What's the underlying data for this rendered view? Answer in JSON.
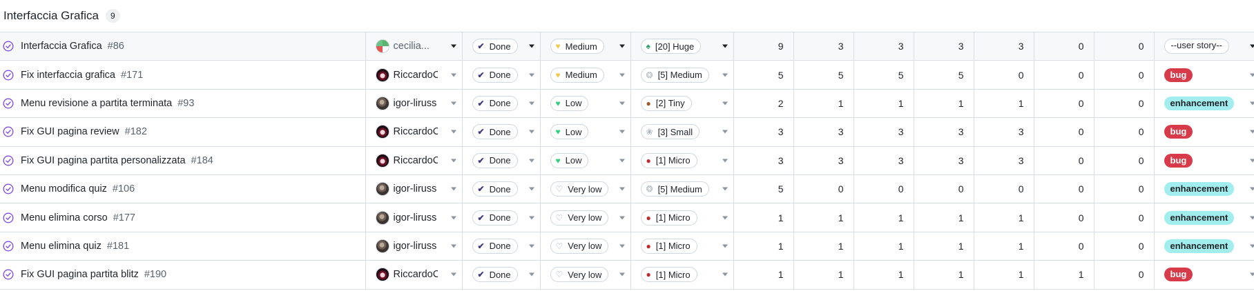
{
  "group": {
    "title": "Interfaccia Grafica",
    "count": "9"
  },
  "colors": {
    "done_check": "#3f3a80",
    "priority_medium": "#f2c94c",
    "priority_low": "#2fd07a",
    "bug_label": "#d73a49",
    "enhancement_label": "#a2eeef",
    "open_circle": "#8250df"
  },
  "rows": [
    {
      "title": "Interfaccia Grafica",
      "number": "#86",
      "assignee": "cecilia...",
      "avatar": "cecilia",
      "status": "Done",
      "priority": "Medium",
      "priority_icon": "yellow-heart-icon",
      "size": "[20] Huge",
      "size_icon": "dinosaur-icon",
      "n1": "9",
      "n2": "3",
      "n3": "3",
      "n4": "3",
      "n5": "3",
      "n6": "0",
      "n7": "0",
      "label": "--user story--",
      "label_kind": "outline",
      "highlight": true
    },
    {
      "title": "Fix interfaccia grafica",
      "number": "#171",
      "assignee": "RiccardoC",
      "avatar": "riccardo",
      "status": "Done",
      "priority": "Medium",
      "priority_icon": "yellow-heart-icon",
      "size": "[5] Medium",
      "size_icon": "goose-icon",
      "n1": "5",
      "n2": "5",
      "n3": "5",
      "n4": "5",
      "n5": "0",
      "n6": "0",
      "n7": "0",
      "label": "bug",
      "label_kind": "bug",
      "highlight": false
    },
    {
      "title": "Menu revisione a partita terminata",
      "number": "#93",
      "assignee": "igor-liruss",
      "avatar": "igor",
      "status": "Done",
      "priority": "Low",
      "priority_icon": "green-heart-icon",
      "size": "[2] Tiny",
      "size_icon": "snail-icon",
      "n1": "2",
      "n2": "1",
      "n3": "1",
      "n4": "1",
      "n5": "1",
      "n6": "0",
      "n7": "0",
      "label": "enhancement",
      "label_kind": "enhancement",
      "highlight": false
    },
    {
      "title": "Fix GUI pagina review",
      "number": "#182",
      "assignee": "RiccardoC",
      "avatar": "riccardo",
      "status": "Done",
      "priority": "Low",
      "priority_icon": "green-heart-icon",
      "size": "[3] Small",
      "size_icon": "rabbit-icon",
      "n1": "3",
      "n2": "3",
      "n3": "3",
      "n4": "3",
      "n5": "3",
      "n6": "0",
      "n7": "0",
      "label": "bug",
      "label_kind": "bug",
      "highlight": false
    },
    {
      "title": "Fix GUI pagina partita personalizzata",
      "number": "#184",
      "assignee": "RiccardoC",
      "avatar": "riccardo",
      "status": "Done",
      "priority": "Low",
      "priority_icon": "green-heart-icon",
      "size": "[1] Micro",
      "size_icon": "ladybug-icon",
      "n1": "3",
      "n2": "3",
      "n3": "3",
      "n4": "3",
      "n5": "3",
      "n6": "0",
      "n7": "0",
      "label": "bug",
      "label_kind": "bug",
      "highlight": false
    },
    {
      "title": "Menu modifica quiz",
      "number": "#106",
      "assignee": "igor-liruss",
      "avatar": "igor",
      "status": "Done",
      "priority": "Very low",
      "priority_icon": "white-heart-icon",
      "size": "[5] Medium",
      "size_icon": "goose-icon",
      "n1": "5",
      "n2": "0",
      "n3": "0",
      "n4": "0",
      "n5": "0",
      "n6": "0",
      "n7": "0",
      "label": "enhancement",
      "label_kind": "enhancement",
      "highlight": false
    },
    {
      "title": "Menu elimina corso",
      "number": "#177",
      "assignee": "igor-liruss",
      "avatar": "igor",
      "status": "Done",
      "priority": "Very low",
      "priority_icon": "white-heart-icon",
      "size": "[1] Micro",
      "size_icon": "ladybug-icon",
      "n1": "1",
      "n2": "1",
      "n3": "1",
      "n4": "1",
      "n5": "1",
      "n6": "0",
      "n7": "0",
      "label": "enhancement",
      "label_kind": "enhancement",
      "highlight": false
    },
    {
      "title": "Menu elimina quiz",
      "number": "#181",
      "assignee": "igor-liruss",
      "avatar": "igor",
      "status": "Done",
      "priority": "Very low",
      "priority_icon": "white-heart-icon",
      "size": "[1] Micro",
      "size_icon": "ladybug-icon",
      "n1": "1",
      "n2": "1",
      "n3": "1",
      "n4": "1",
      "n5": "1",
      "n6": "0",
      "n7": "0",
      "label": "enhancement",
      "label_kind": "enhancement",
      "highlight": false
    },
    {
      "title": "Fix GUI pagina partita blitz",
      "number": "#190",
      "assignee": "RiccardoC",
      "avatar": "riccardo",
      "status": "Done",
      "priority": "Very low",
      "priority_icon": "white-heart-icon",
      "size": "[1] Micro",
      "size_icon": "ladybug-icon",
      "n1": "1",
      "n2": "1",
      "n3": "1",
      "n4": "1",
      "n5": "1",
      "n6": "1",
      "n7": "0",
      "label": "bug",
      "label_kind": "bug",
      "highlight": false
    }
  ]
}
